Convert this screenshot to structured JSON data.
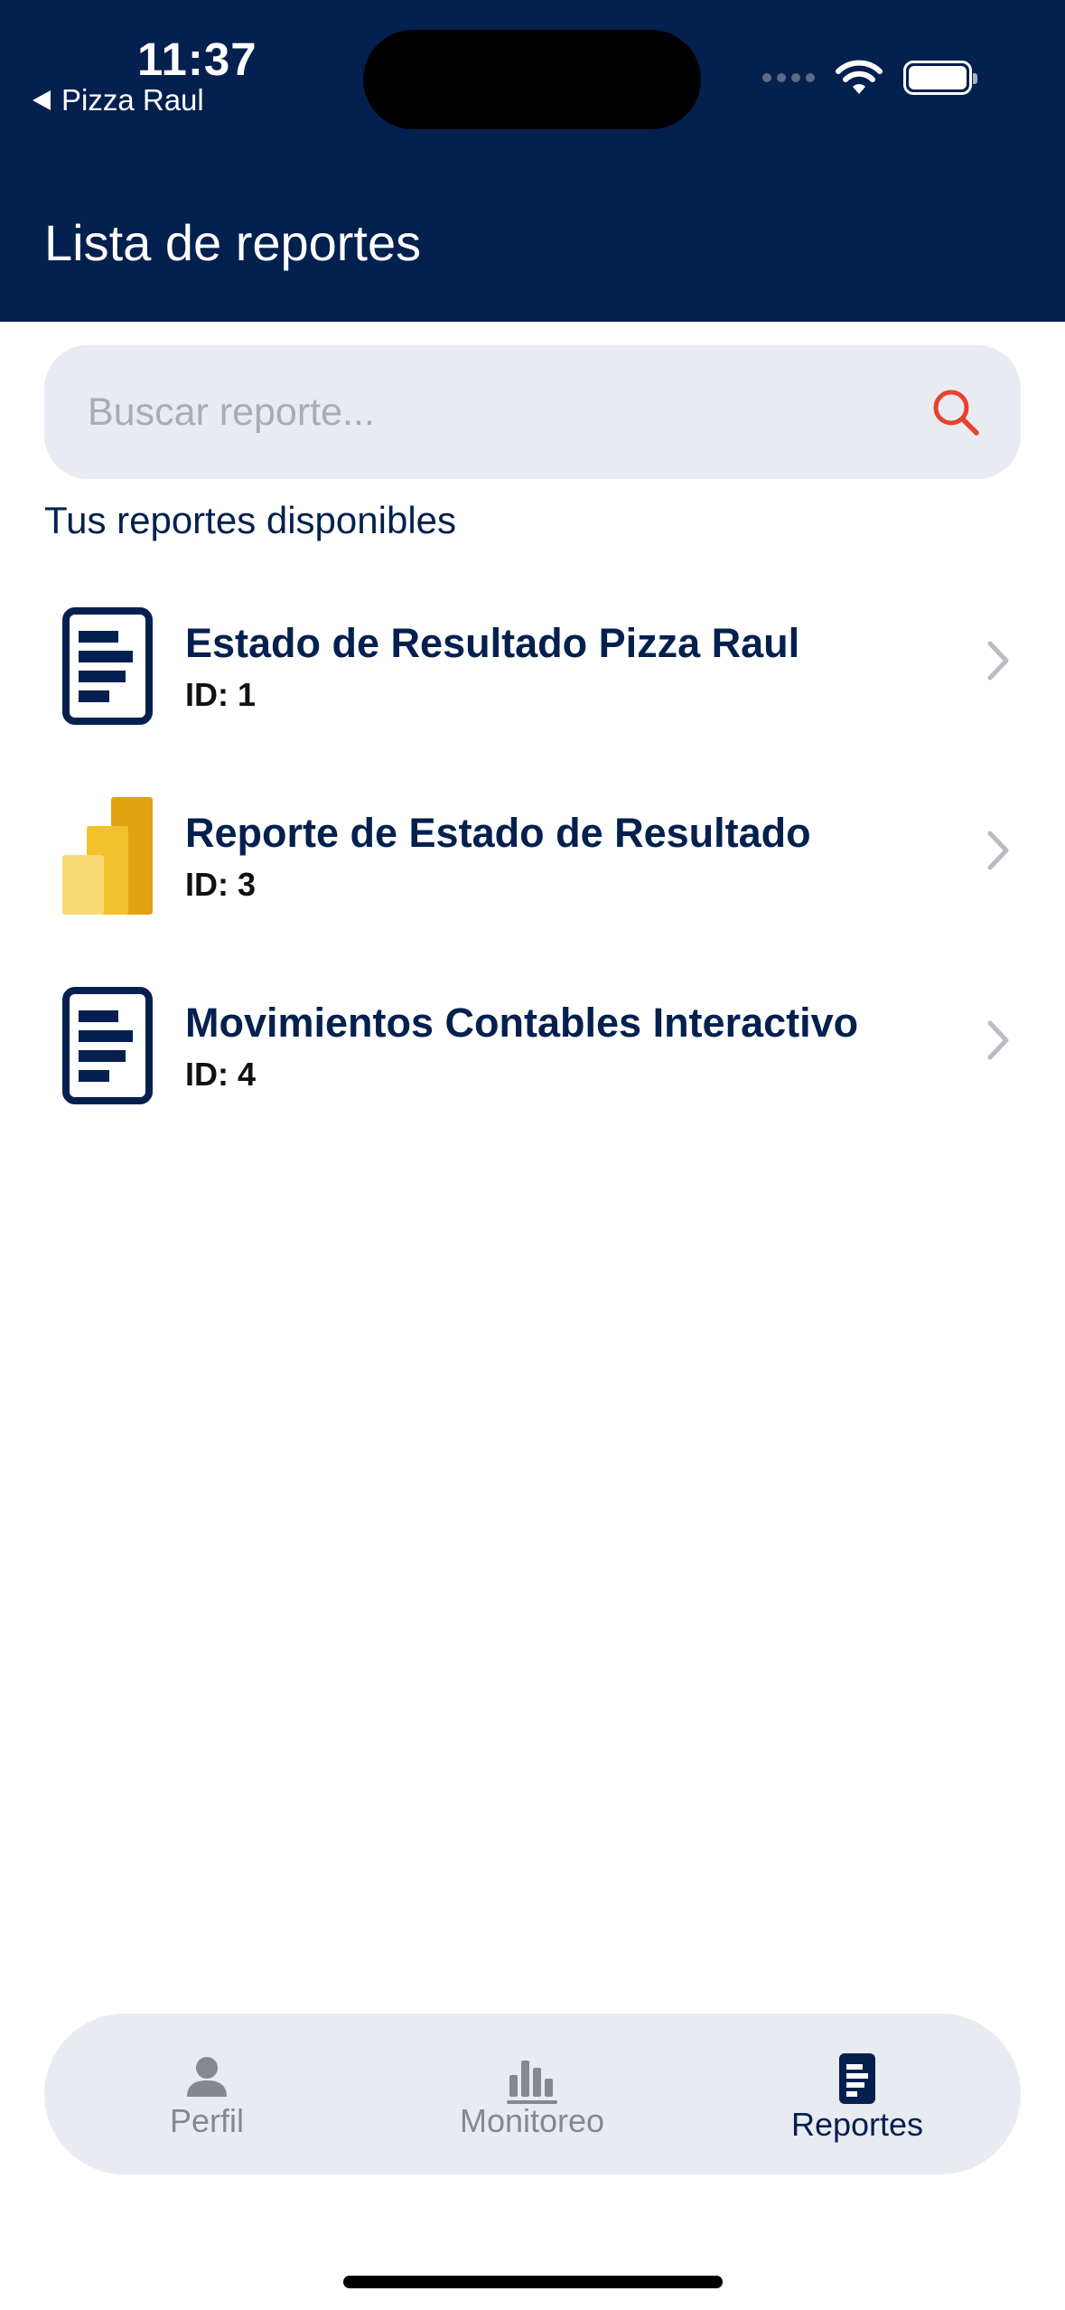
{
  "status_bar": {
    "time": "11:37",
    "back_app": "Pizza Raul"
  },
  "header": {
    "title": "Lista de reportes",
    "background_color": "#03204f"
  },
  "search": {
    "placeholder": "Buscar reporte...",
    "icon": "search-icon",
    "icon_color": "#e8412b"
  },
  "section": {
    "subtitle": "Tus reportes disponibles"
  },
  "reports": [
    {
      "title": "Estado de Resultado Pizza Raul",
      "id_label": "ID: 1",
      "icon": "document-report-icon"
    },
    {
      "title": "Reporte de Estado de Resultado",
      "id_label": "ID: 3",
      "icon": "power-bi-icon"
    },
    {
      "title": "Movimientos Contables Interactivo",
      "id_label": "ID: 4",
      "icon": "document-report-icon"
    }
  ],
  "tabbar": {
    "tabs": [
      {
        "label": "Perfil",
        "icon": "person-icon",
        "active": false
      },
      {
        "label": "Monitoreo",
        "icon": "bar-chart-icon",
        "active": false
      },
      {
        "label": "Reportes",
        "icon": "report-icon",
        "active": true
      }
    ]
  }
}
